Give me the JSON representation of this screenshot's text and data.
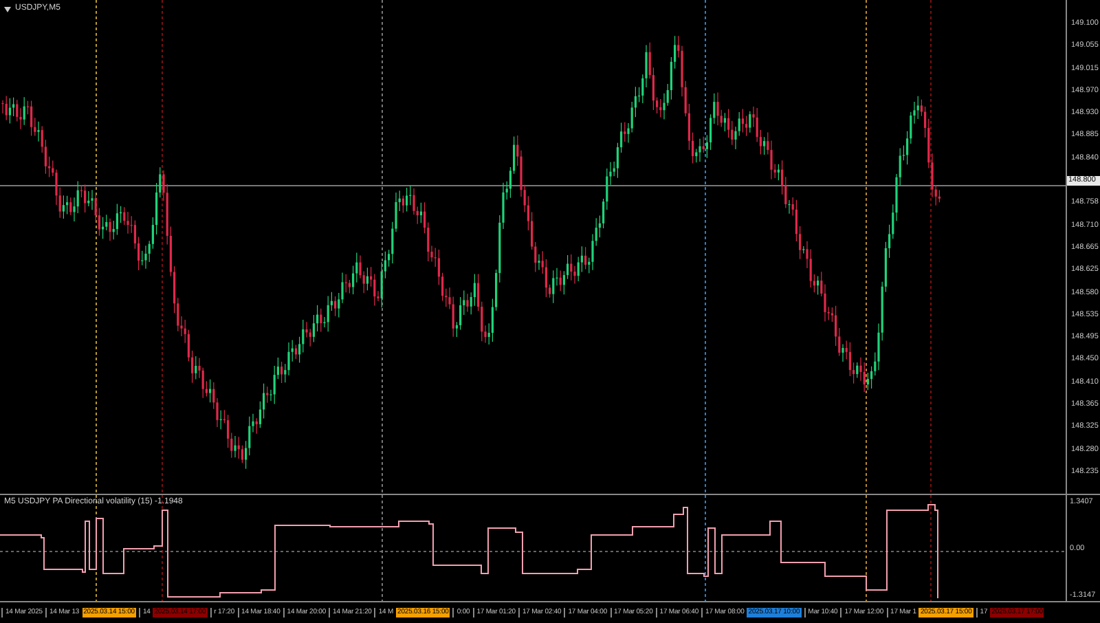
{
  "chart": {
    "title": "USDJPY,M5"
  },
  "price_axis": [
    {
      "text": "149.100",
      "kind": "tick"
    },
    {
      "text": "149.055",
      "kind": "tick"
    },
    {
      "text": "149.015",
      "kind": "tick"
    },
    {
      "text": "148.970",
      "kind": "tick"
    },
    {
      "text": "148.930",
      "kind": "tick"
    },
    {
      "text": "148.885",
      "kind": "tick"
    },
    {
      "text": "148.840",
      "kind": "tick"
    },
    {
      "text": "148.800",
      "kind": "current"
    },
    {
      "text": "148.758",
      "kind": "tick"
    },
    {
      "text": "148.710",
      "kind": "tick"
    },
    {
      "text": "148.665",
      "kind": "tick"
    },
    {
      "text": "148.625",
      "kind": "tick"
    },
    {
      "text": "148.580",
      "kind": "tick"
    },
    {
      "text": "148.535",
      "kind": "tick"
    },
    {
      "text": "148.495",
      "kind": "tick"
    },
    {
      "text": "148.450",
      "kind": "tick"
    },
    {
      "text": "148.410",
      "kind": "tick"
    },
    {
      "text": "148.365",
      "kind": "tick"
    },
    {
      "text": "148.325",
      "kind": "tick"
    },
    {
      "text": "148.280",
      "kind": "tick"
    },
    {
      "text": "148.235",
      "kind": "tick"
    }
  ],
  "indicator": {
    "label": "M5 USDJPY PA Directional volatility (15) -1.1948",
    "axis": [
      "1.3407",
      "0.00",
      "-1.3147"
    ]
  },
  "time_axis": [
    {
      "text": "14 Mar 2025",
      "kind": "tick"
    },
    {
      "text": "14 Mar 13",
      "kind": "tick"
    },
    {
      "text": "2025.03.14 15:00",
      "kind": "marker",
      "color": "#f5a000"
    },
    {
      "text": "14",
      "kind": "tick"
    },
    {
      "text": "2025.03.14 17:00",
      "kind": "marker",
      "color": "#8b0000"
    },
    {
      "text": "r 17:20",
      "kind": "tick"
    },
    {
      "text": "14 Mar 18:40",
      "kind": "tick"
    },
    {
      "text": "14 Mar 20:00",
      "kind": "tick"
    },
    {
      "text": "14 Mar 21:20",
      "kind": "tick"
    },
    {
      "text": "14 M",
      "kind": "tick"
    },
    {
      "text": "2025.03.16 15:00",
      "kind": "marker",
      "color": "#f5a000"
    },
    {
      "text": "0:00",
      "kind": "tick"
    },
    {
      "text": "17 Mar 01:20",
      "kind": "tick"
    },
    {
      "text": "17 Mar 02:40",
      "kind": "tick"
    },
    {
      "text": "17 Mar 04:00",
      "kind": "tick"
    },
    {
      "text": "17 Mar 05:20",
      "kind": "tick"
    },
    {
      "text": "17 Mar 06:40",
      "kind": "tick"
    },
    {
      "text": "17 Mar 08:00",
      "kind": "tick"
    },
    {
      "text": "2025.03.17 10:00",
      "kind": "marker",
      "color": "#1e7fd8"
    },
    {
      "text": "Mar 10:40",
      "kind": "tick"
    },
    {
      "text": "17 Mar 12:00",
      "kind": "tick"
    },
    {
      "text": "17 Mar 1",
      "kind": "tick"
    },
    {
      "text": "2025.03.17 15:00",
      "kind": "marker",
      "color": "#f5a000"
    },
    {
      "text": "17",
      "kind": "tick"
    },
    {
      "text": "2025.03.17 17:00",
      "kind": "marker",
      "color": "#8b0000"
    }
  ]
}
